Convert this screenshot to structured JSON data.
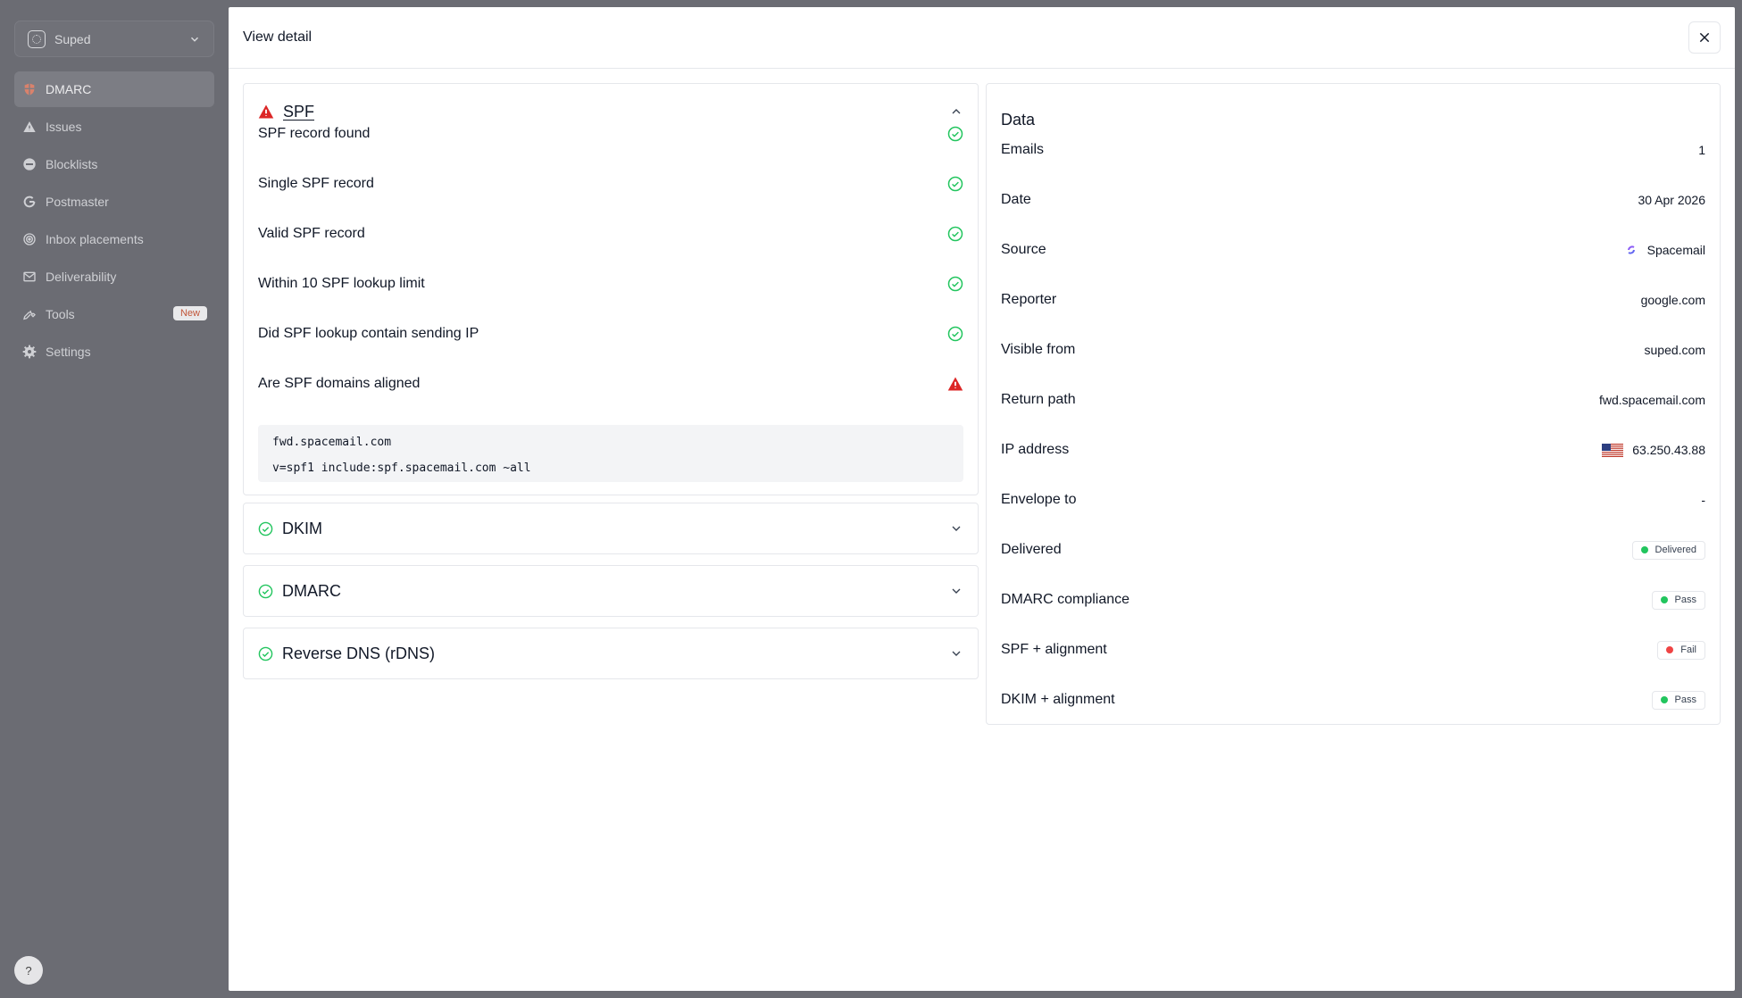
{
  "sidebar": {
    "org_name": "Suped",
    "items": [
      {
        "label": "DMARC",
        "active": true
      },
      {
        "label": "Issues"
      },
      {
        "label": "Blocklists"
      },
      {
        "label": "Postmaster"
      },
      {
        "label": "Inbox placements"
      },
      {
        "label": "Deliverability"
      },
      {
        "label": "Tools",
        "badge": "New"
      },
      {
        "label": "Settings"
      }
    ],
    "help_label": "?"
  },
  "modal": {
    "title": "View detail"
  },
  "spf": {
    "title": "SPF",
    "checks": [
      {
        "label": "SPF record found",
        "status": "pass"
      },
      {
        "label": "Single SPF record",
        "status": "pass"
      },
      {
        "label": "Valid SPF record",
        "status": "pass"
      },
      {
        "label": "Within 10 SPF lookup limit",
        "status": "pass"
      },
      {
        "label": "Did SPF lookup contain sending IP",
        "status": "pass"
      },
      {
        "label": "Are SPF domains aligned",
        "status": "warning"
      }
    ],
    "code_lines": [
      "fwd.spacemail.com",
      "v=spf1 include:spf.spacemail.com ~all"
    ]
  },
  "accordions": [
    {
      "title": "DKIM",
      "status": "pass"
    },
    {
      "title": "DMARC",
      "status": "pass"
    },
    {
      "title": "Reverse DNS (rDNS)",
      "status": "pass"
    }
  ],
  "data_panel": {
    "title": "Data",
    "rows": {
      "emails": {
        "label": "Emails",
        "value": "1"
      },
      "date": {
        "label": "Date",
        "value": "30 Apr 2026"
      },
      "source": {
        "label": "Source",
        "value": "Spacemail"
      },
      "reporter": {
        "label": "Reporter",
        "value": "google.com"
      },
      "visible_from": {
        "label": "Visible from",
        "value": "suped.com"
      },
      "return_path": {
        "label": "Return path",
        "value": "fwd.spacemail.com"
      },
      "ip_address": {
        "label": "IP address",
        "value": "63.250.43.88"
      },
      "envelope_to": {
        "label": "Envelope to",
        "value": "-"
      },
      "delivered": {
        "label": "Delivered",
        "value": "Delivered"
      },
      "dmarc_compliance": {
        "label": "DMARC compliance",
        "value": "Pass"
      },
      "spf_alignment": {
        "label": "SPF + alignment",
        "value": "Fail"
      },
      "dkim_alignment": {
        "label": "DKIM + alignment",
        "value": "Pass"
      }
    }
  },
  "colors": {
    "pass": "#22c55e",
    "fail": "#ef4444",
    "warning": "#dc2626",
    "overlay": "#6b6c73"
  }
}
